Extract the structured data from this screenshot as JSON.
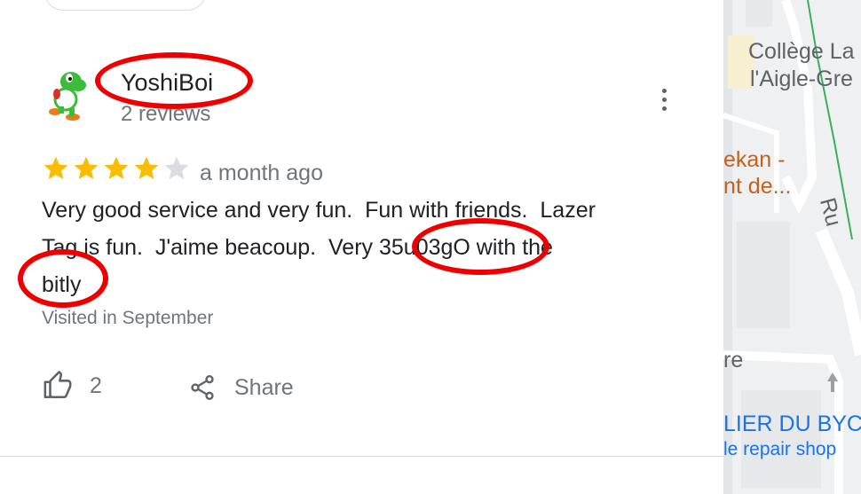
{
  "review": {
    "reviewer_name": "YoshiBoi",
    "review_count": "2 reviews",
    "rating": 4,
    "max_rating": 5,
    "time_ago": "a month ago",
    "text_line1": "Very good service and very fun.  Fun with friends.  Lazer",
    "text_line2": "Tag is fun.  J'aime beacoup.  Very 35u03gO with the",
    "text_line3": "bitly",
    "visited": "Visited in September",
    "like_count": "2",
    "share_label": "Share"
  },
  "map": {
    "label_school_line1": "Collège La",
    "label_school_line2": "l'Aigle-Gre",
    "label_place_line1": "ekan -",
    "label_place_line2": "nt de...",
    "label_street": "Ru",
    "label_partial": "re",
    "label_shop_name": "LIER DU BYC",
    "label_shop_type": "le repair shop"
  },
  "colors": {
    "star_filled": "#fbbc04",
    "star_empty": "#dadce0",
    "annotation": "#e00000",
    "map_orange": "#c5611b",
    "map_blue": "#1a73e8",
    "map_gray": "#5f6368"
  },
  "icons": [
    "yoshi-avatar",
    "more-vert-icon",
    "star-icon",
    "thumbs-up-icon",
    "share-icon",
    "arrow-up-icon"
  ]
}
